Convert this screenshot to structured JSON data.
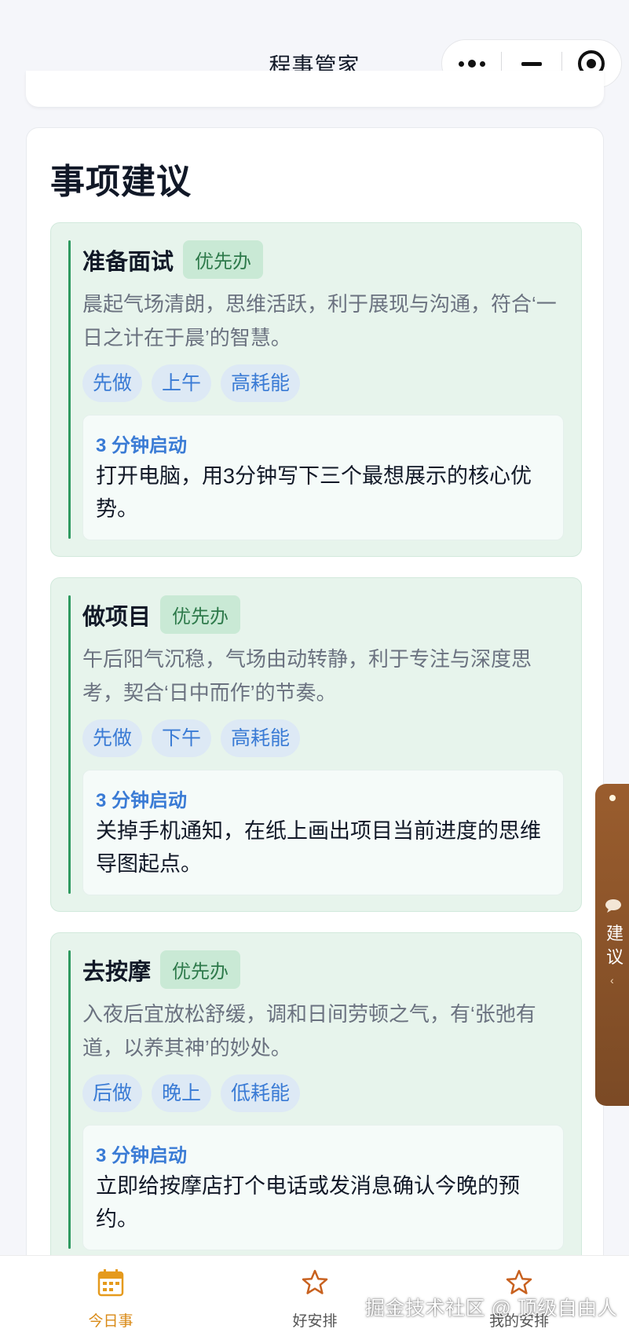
{
  "navbar": {
    "title": "程事管家"
  },
  "section": {
    "title": "事项建议"
  },
  "suggestions": [
    {
      "title": "准备面试",
      "priority": "优先办",
      "description": "晨起气场清朗，思维活跃，利于展现与沟通，符合‘一日之计在于晨’的智慧。",
      "tags": [
        "先做",
        "上午",
        "高耗能"
      ],
      "start_label": "3 分钟启动",
      "start_text": "打开电脑，用3分钟写下三个最想展示的核心优势。"
    },
    {
      "title": "做项目",
      "priority": "优先办",
      "description": "午后阳气沉稳，气场由动转静，利于专注与深度思考，契合‘日中而作’的节奏。",
      "tags": [
        "先做",
        "下午",
        "高耗能"
      ],
      "start_label": "3 分钟启动",
      "start_text": "关掉手机通知，在纸上画出项目当前进度的思维导图起点。"
    },
    {
      "title": "去按摩",
      "priority": "优先办",
      "description": "入夜后宜放松舒缓，调和日间劳顿之气，有‘张弛有道，以养其神’的妙处。",
      "tags": [
        "后做",
        "晚上",
        "低耗能"
      ],
      "start_label": "3 分钟启动",
      "start_text": "立即给按摩店打个电话或发消息确认今晚的预约。"
    }
  ],
  "float_tab": {
    "label": "建议",
    "icon": "chat-bubble-icon",
    "arrow": "‹"
  },
  "tabbar": {
    "items": [
      {
        "label": "今日事",
        "icon": "calendar-icon",
        "active": true
      },
      {
        "label": "好安排",
        "icon": "star-icon",
        "active": false
      },
      {
        "label": "我的安排",
        "icon": "star-icon",
        "active": false
      }
    ]
  },
  "watermark": "掘金技术社区 @ 顶级自由人",
  "colors": {
    "accent_green": "#2e9a60",
    "tag_blue": "#3a7bd5",
    "tab_active": "#d98a16",
    "float_tab_brown": "#8b5530"
  }
}
